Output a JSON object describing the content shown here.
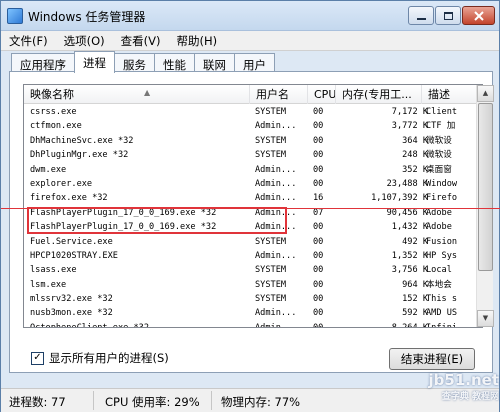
{
  "window": {
    "title": "Windows 任务管理器"
  },
  "menu": [
    "文件(F)",
    "选项(O)",
    "查看(V)",
    "帮助(H)"
  ],
  "tabs": [
    {
      "label": "应用程序",
      "active": false
    },
    {
      "label": "进程",
      "active": true
    },
    {
      "label": "服务",
      "active": false
    },
    {
      "label": "性能",
      "active": false
    },
    {
      "label": "联网",
      "active": false
    },
    {
      "label": "用户",
      "active": false
    }
  ],
  "columns": {
    "name": "映像名称",
    "user": "用户名",
    "cpu": "CPU",
    "mem": "内存(专用工...",
    "desc": "描述"
  },
  "rows": [
    {
      "name": "csrss.exe",
      "user": "SYSTEM",
      "cpu": "00",
      "mem": "7,172 K",
      "desc": "Client"
    },
    {
      "name": "ctfmon.exe",
      "user": "Admin...",
      "cpu": "00",
      "mem": "3,772 K",
      "desc": "CTF 加"
    },
    {
      "name": "DhMachineSvc.exe *32",
      "user": "SYSTEM",
      "cpu": "00",
      "mem": "364 K",
      "desc": "微软设"
    },
    {
      "name": "DhPluginMgr.exe *32",
      "user": "SYSTEM",
      "cpu": "00",
      "mem": "248 K",
      "desc": "微软设"
    },
    {
      "name": "dwm.exe",
      "user": "Admin...",
      "cpu": "00",
      "mem": "352 K",
      "desc": "桌面窗"
    },
    {
      "name": "explorer.exe",
      "user": "Admin...",
      "cpu": "00",
      "mem": "23,488 K",
      "desc": "Window"
    },
    {
      "name": "firefox.exe *32",
      "user": "Admin...",
      "cpu": "16",
      "mem": "1,107,392 K",
      "desc": "Firefo"
    },
    {
      "name": "FlashPlayerPlugin_17_0_0_169.exe *32",
      "user": "Admin...",
      "cpu": "07",
      "mem": "90,456 K",
      "desc": "Adobe"
    },
    {
      "name": "FlashPlayerPlugin_17_0_0_169.exe *32",
      "user": "Admin...",
      "cpu": "00",
      "mem": "1,432 K",
      "desc": "Adobe"
    },
    {
      "name": "Fuel.Service.exe",
      "user": "SYSTEM",
      "cpu": "00",
      "mem": "492 K",
      "desc": "Fusion"
    },
    {
      "name": "HPCP1020STRAY.EXE",
      "user": "Admin...",
      "cpu": "00",
      "mem": "1,352 K",
      "desc": "HP Sys"
    },
    {
      "name": "lsass.exe",
      "user": "SYSTEM",
      "cpu": "00",
      "mem": "3,756 K",
      "desc": "Local"
    },
    {
      "name": "lsm.exe",
      "user": "SYSTEM",
      "cpu": "00",
      "mem": "964 K",
      "desc": "本地会"
    },
    {
      "name": "mlssrv32.exe *32",
      "user": "SYSTEM",
      "cpu": "00",
      "mem": "152 K",
      "desc": "This s"
    },
    {
      "name": "nusb3mon.exe *32",
      "user": "Admin...",
      "cpu": "00",
      "mem": "592 K",
      "desc": "AMD US"
    },
    {
      "name": "OctopheneClient.exe *32",
      "user": "Admin...",
      "cpu": "00",
      "mem": "8,264 K",
      "desc": "Infini"
    }
  ],
  "show_all_label": "显示所有用户的进程(S)",
  "show_all_checked": true,
  "end_process_label": "结束进程(E)",
  "status": {
    "processes": "进程数: 77",
    "cpu": "CPU 使用率: 29%",
    "memory": "物理内存: 77%"
  },
  "watermark": {
    "top": "jb51.net",
    "bottom": "查字典 教程网"
  },
  "colors": {
    "highlight": "#e0343a",
    "accent": "#2f7ad6"
  }
}
